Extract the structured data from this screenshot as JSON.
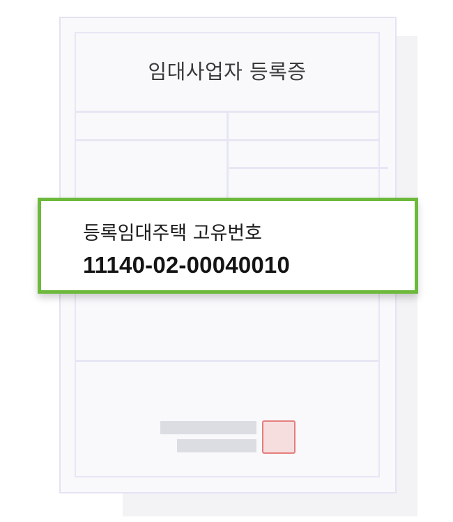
{
  "document": {
    "title": "임대사업자 등록증"
  },
  "callout": {
    "label": "등록임대주택 고유번호",
    "number": "11140-02-00040010"
  },
  "colors": {
    "callout_border": "#6cb93c",
    "document_border": "#e3e3f3",
    "seal_border": "#e57d7d",
    "seal_fill": "#f6dede"
  }
}
